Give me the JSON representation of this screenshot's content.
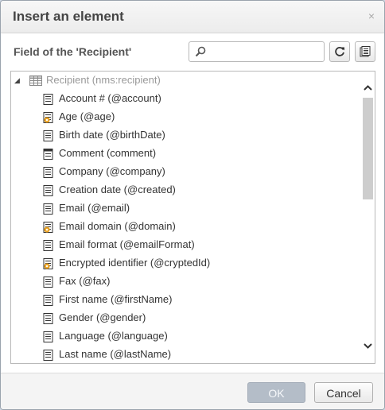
{
  "dialog": {
    "title": "Insert an element",
    "close_glyph": "×",
    "field_label": "Field of the 'Recipient'",
    "search": {
      "value": "",
      "placeholder": ""
    },
    "tools": [
      {
        "icon": "refresh-icon"
      },
      {
        "icon": "list-icon"
      }
    ]
  },
  "tree": {
    "root": {
      "label": "Recipient (nms:recipient)",
      "icon": "table-icon",
      "expanded": true
    },
    "items": [
      {
        "label": "Account # (@account)",
        "icon": "field-icon"
      },
      {
        "label": "Age (@age)",
        "icon": "computed-field-icon"
      },
      {
        "label": "Birth date (@birthDate)",
        "icon": "field-icon"
      },
      {
        "label": "Comment (comment)",
        "icon": "element-field-icon"
      },
      {
        "label": "Company (@company)",
        "icon": "field-icon"
      },
      {
        "label": "Creation date (@created)",
        "icon": "field-icon"
      },
      {
        "label": "Email (@email)",
        "icon": "field-icon"
      },
      {
        "label": "Email domain (@domain)",
        "icon": "computed-field-icon"
      },
      {
        "label": "Email format (@emailFormat)",
        "icon": "field-icon"
      },
      {
        "label": "Encrypted identifier (@cryptedId)",
        "icon": "computed-field-icon"
      },
      {
        "label": "Fax (@fax)",
        "icon": "field-icon"
      },
      {
        "label": "First name (@firstName)",
        "icon": "field-icon"
      },
      {
        "label": "Gender (@gender)",
        "icon": "field-icon"
      },
      {
        "label": "Language (@language)",
        "icon": "field-icon"
      },
      {
        "label": "Last name (@lastName)",
        "icon": "field-icon"
      }
    ]
  },
  "buttons": {
    "ok": "OK",
    "cancel": "Cancel"
  },
  "colors": {
    "ok_disabled_bg": "#b4bdc8",
    "computed_badge": "#e8a020"
  }
}
